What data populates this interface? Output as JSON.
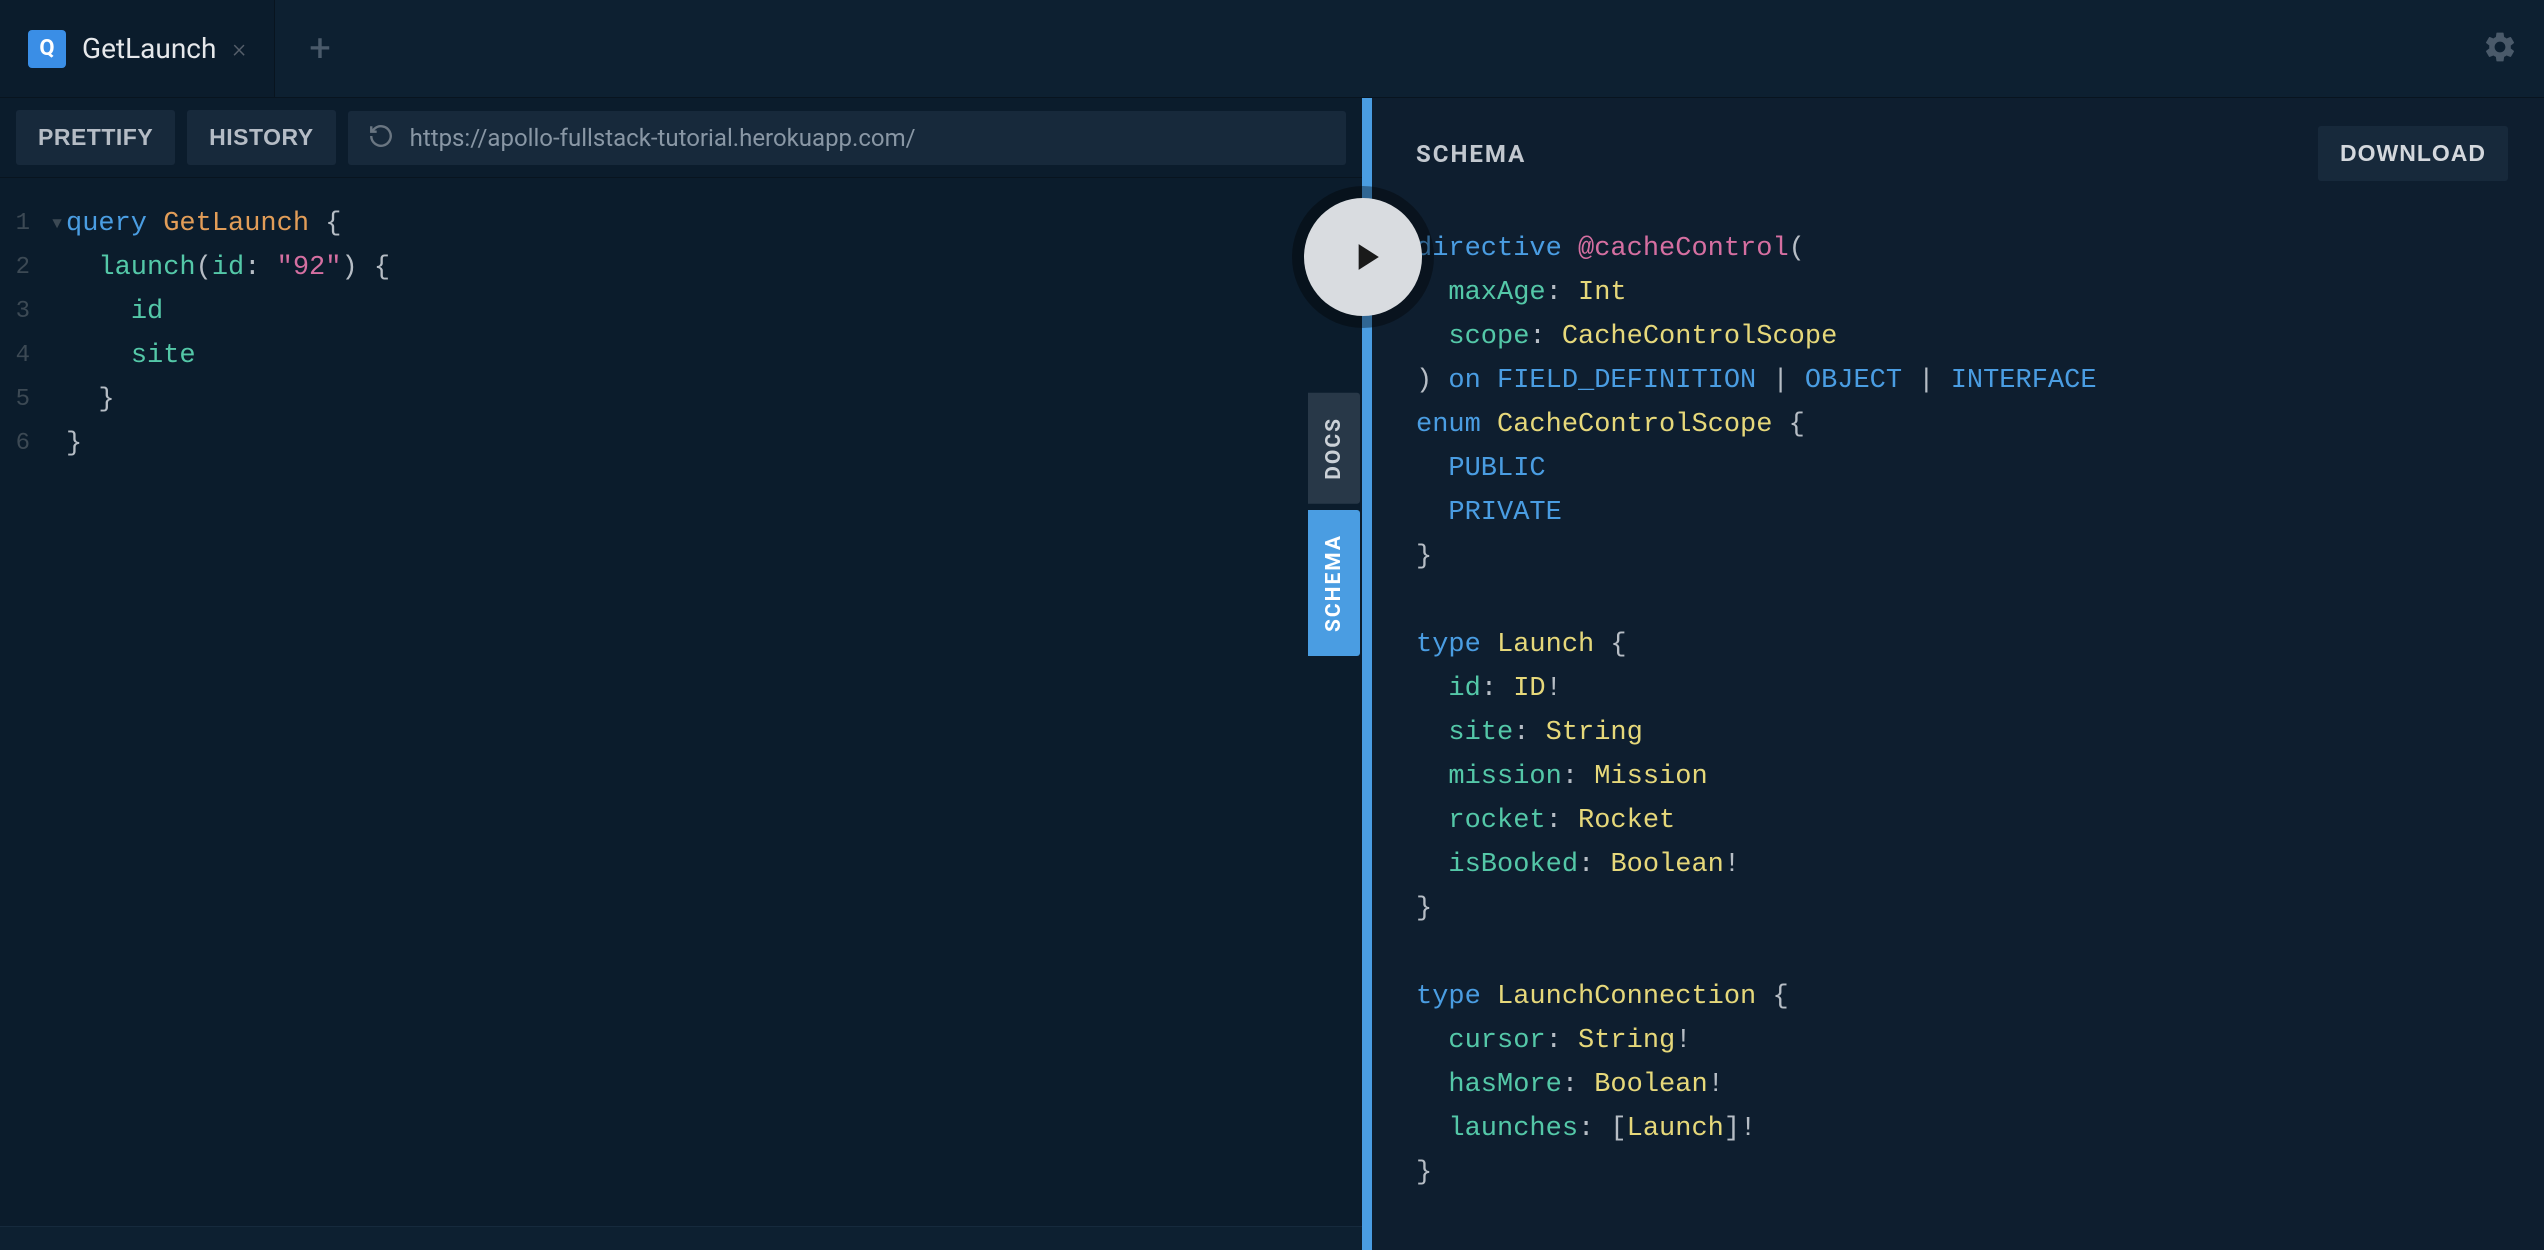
{
  "tabs": {
    "active": {
      "icon_letter": "Q",
      "title": "GetLaunch"
    }
  },
  "toolbar": {
    "prettify": "PRETTIFY",
    "history": "HISTORY",
    "url": "https://apollo-fullstack-tutorial.herokuapp.com/"
  },
  "editor": {
    "lines": [
      {
        "n": "1",
        "fold": true,
        "tokens": [
          [
            "kw",
            "query "
          ],
          [
            "def",
            "GetLaunch "
          ],
          [
            "punc",
            "{"
          ]
        ]
      },
      {
        "n": "2",
        "fold": false,
        "tokens": [
          [
            "punc",
            "  "
          ],
          [
            "attr",
            "launch"
          ],
          [
            "punc",
            "("
          ],
          [
            "attr",
            "id"
          ],
          [
            "punc",
            ": "
          ],
          [
            "str",
            "\"92\""
          ],
          [
            "punc",
            ") {"
          ]
        ]
      },
      {
        "n": "3",
        "fold": false,
        "tokens": [
          [
            "punc",
            "    "
          ],
          [
            "attr",
            "id"
          ]
        ]
      },
      {
        "n": "4",
        "fold": false,
        "tokens": [
          [
            "punc",
            "    "
          ],
          [
            "attr",
            "site"
          ]
        ]
      },
      {
        "n": "5",
        "fold": false,
        "tokens": [
          [
            "punc",
            "  }"
          ]
        ]
      },
      {
        "n": "6",
        "fold": false,
        "tokens": [
          [
            "punc",
            "}"
          ]
        ]
      }
    ]
  },
  "side_tabs": {
    "docs": "DOCS",
    "schema": "SCHEMA"
  },
  "schema_panel": {
    "title": "SCHEMA",
    "download": "DOWNLOAD",
    "lines": [
      [
        [
          "kw",
          "directive"
        ],
        [
          "punc",
          " "
        ],
        [
          "dir",
          "@cacheControl"
        ],
        [
          "punc",
          "("
        ]
      ],
      [
        [
          "punc",
          "  "
        ],
        [
          "field",
          "maxAge"
        ],
        [
          "punc",
          ": "
        ],
        [
          "builtin",
          "Int"
        ]
      ],
      [
        [
          "punc",
          "  "
        ],
        [
          "field",
          "scope"
        ],
        [
          "punc",
          ": "
        ],
        [
          "builtin",
          "CacheControlScope"
        ]
      ],
      [
        [
          "punc",
          ") "
        ],
        [
          "kw",
          "on"
        ],
        [
          "punc",
          " "
        ],
        [
          "typeref",
          "FIELD_DEFINITION"
        ],
        [
          "punc",
          " | "
        ],
        [
          "typeref",
          "OBJECT"
        ],
        [
          "punc",
          " | "
        ],
        [
          "typeref",
          "INTERFACE"
        ]
      ],
      [
        [
          "kw",
          "enum"
        ],
        [
          "punc",
          " "
        ],
        [
          "builtin",
          "CacheControlScope"
        ],
        [
          "punc",
          " {"
        ]
      ],
      [
        [
          "punc",
          "  "
        ],
        [
          "typeref",
          "PUBLIC"
        ]
      ],
      [
        [
          "punc",
          "  "
        ],
        [
          "typeref",
          "PRIVATE"
        ]
      ],
      [
        [
          "punc",
          "}"
        ]
      ],
      [],
      [
        [
          "kw",
          "type"
        ],
        [
          "punc",
          " "
        ],
        [
          "builtin",
          "Launch"
        ],
        [
          "punc",
          " {"
        ]
      ],
      [
        [
          "punc",
          "  "
        ],
        [
          "field",
          "id"
        ],
        [
          "punc",
          ": "
        ],
        [
          "builtin",
          "ID"
        ],
        [
          "punc",
          "!"
        ]
      ],
      [
        [
          "punc",
          "  "
        ],
        [
          "field",
          "site"
        ],
        [
          "punc",
          ": "
        ],
        [
          "builtin",
          "String"
        ]
      ],
      [
        [
          "punc",
          "  "
        ],
        [
          "field",
          "mission"
        ],
        [
          "punc",
          ": "
        ],
        [
          "builtin",
          "Mission"
        ]
      ],
      [
        [
          "punc",
          "  "
        ],
        [
          "field",
          "rocket"
        ],
        [
          "punc",
          ": "
        ],
        [
          "builtin",
          "Rocket"
        ]
      ],
      [
        [
          "punc",
          "  "
        ],
        [
          "field",
          "isBooked"
        ],
        [
          "punc",
          ": "
        ],
        [
          "builtin",
          "Boolean"
        ],
        [
          "punc",
          "!"
        ]
      ],
      [
        [
          "punc",
          "}"
        ]
      ],
      [],
      [
        [
          "kw",
          "type"
        ],
        [
          "punc",
          " "
        ],
        [
          "builtin",
          "LaunchConnection"
        ],
        [
          "punc",
          " {"
        ]
      ],
      [
        [
          "punc",
          "  "
        ],
        [
          "field",
          "cursor"
        ],
        [
          "punc",
          ": "
        ],
        [
          "builtin",
          "String"
        ],
        [
          "punc",
          "!"
        ]
      ],
      [
        [
          "punc",
          "  "
        ],
        [
          "field",
          "hasMore"
        ],
        [
          "punc",
          ": "
        ],
        [
          "builtin",
          "Boolean"
        ],
        [
          "punc",
          "!"
        ]
      ],
      [
        [
          "punc",
          "  "
        ],
        [
          "field",
          "launches"
        ],
        [
          "punc",
          ": ["
        ],
        [
          "builtin",
          "Launch"
        ],
        [
          "punc",
          "]!"
        ]
      ],
      [
        [
          "punc",
          "}"
        ]
      ]
    ]
  }
}
